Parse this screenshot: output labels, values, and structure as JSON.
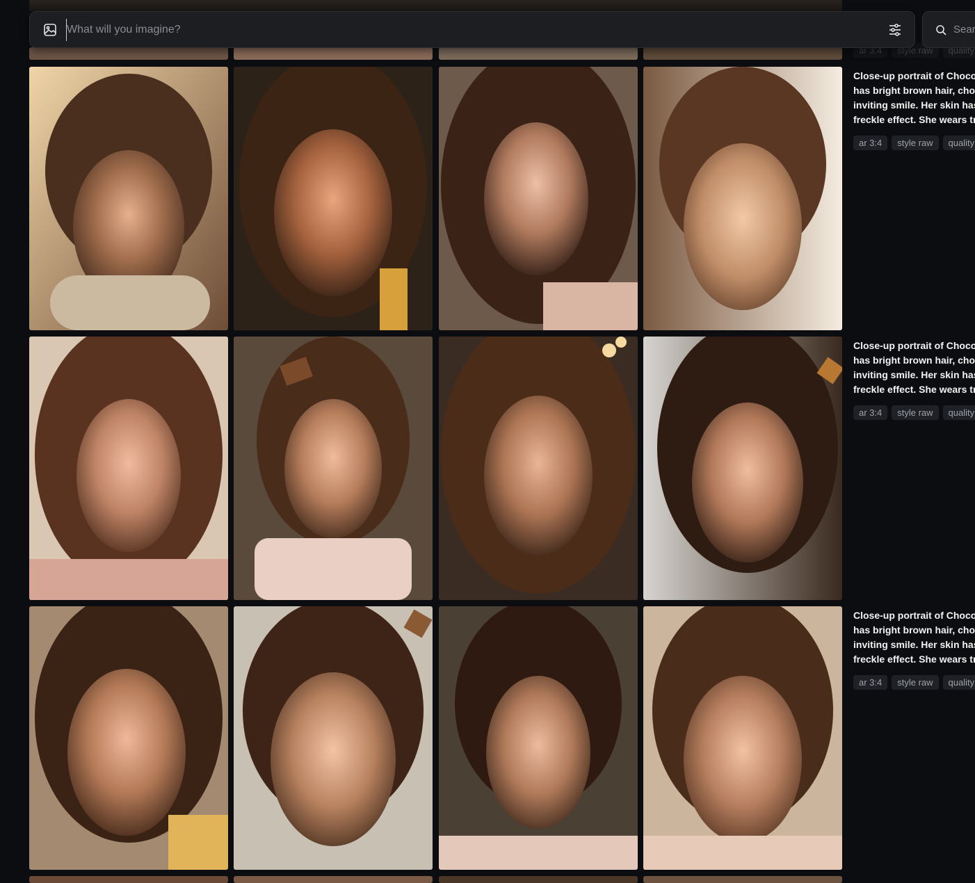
{
  "header": {
    "imagine_placeholder": "What will you imagine?",
    "search_placeholder": "Search",
    "icons": [
      "image-icon",
      "settings-sliders-icon",
      "search-icon"
    ]
  },
  "top_partial_row": {
    "tags": [
      "ar 3:4",
      "style raw",
      "quality"
    ]
  },
  "rows": [
    {
      "prompt_lines": [
        "Close-up portrait of Choco",
        "has bright brown hair, choc",
        "inviting smile. Her skin has",
        "freckle effect. She wears tr"
      ],
      "tags": [
        "ar 3:4",
        "style raw",
        "quality"
      ],
      "images": [
        "portrait-1",
        "portrait-2",
        "portrait-3",
        "portrait-4"
      ]
    },
    {
      "prompt_lines": [
        "Close-up portrait of Choco",
        "has bright brown hair, choc",
        "inviting smile. Her skin has",
        "freckle effect. She wears tr"
      ],
      "tags": [
        "ar 3:4",
        "style raw",
        "quality"
      ],
      "images": [
        "portrait-5",
        "portrait-6",
        "portrait-7",
        "portrait-8"
      ]
    },
    {
      "prompt_lines": [
        "Close-up portrait of Choco",
        "has bright brown hair, choc",
        "inviting smile. Her skin has",
        "freckle effect. She wears tr"
      ],
      "tags": [
        "ar 3:4",
        "style raw",
        "quality"
      ],
      "images": [
        "portrait-9",
        "portrait-10",
        "portrait-11",
        "portrait-12"
      ]
    }
  ],
  "colors": {
    "background": "#0c0d10",
    "bar": "#1c1e22",
    "tag_bg": "#1f2126",
    "tag_text": "#9ea2aa"
  }
}
